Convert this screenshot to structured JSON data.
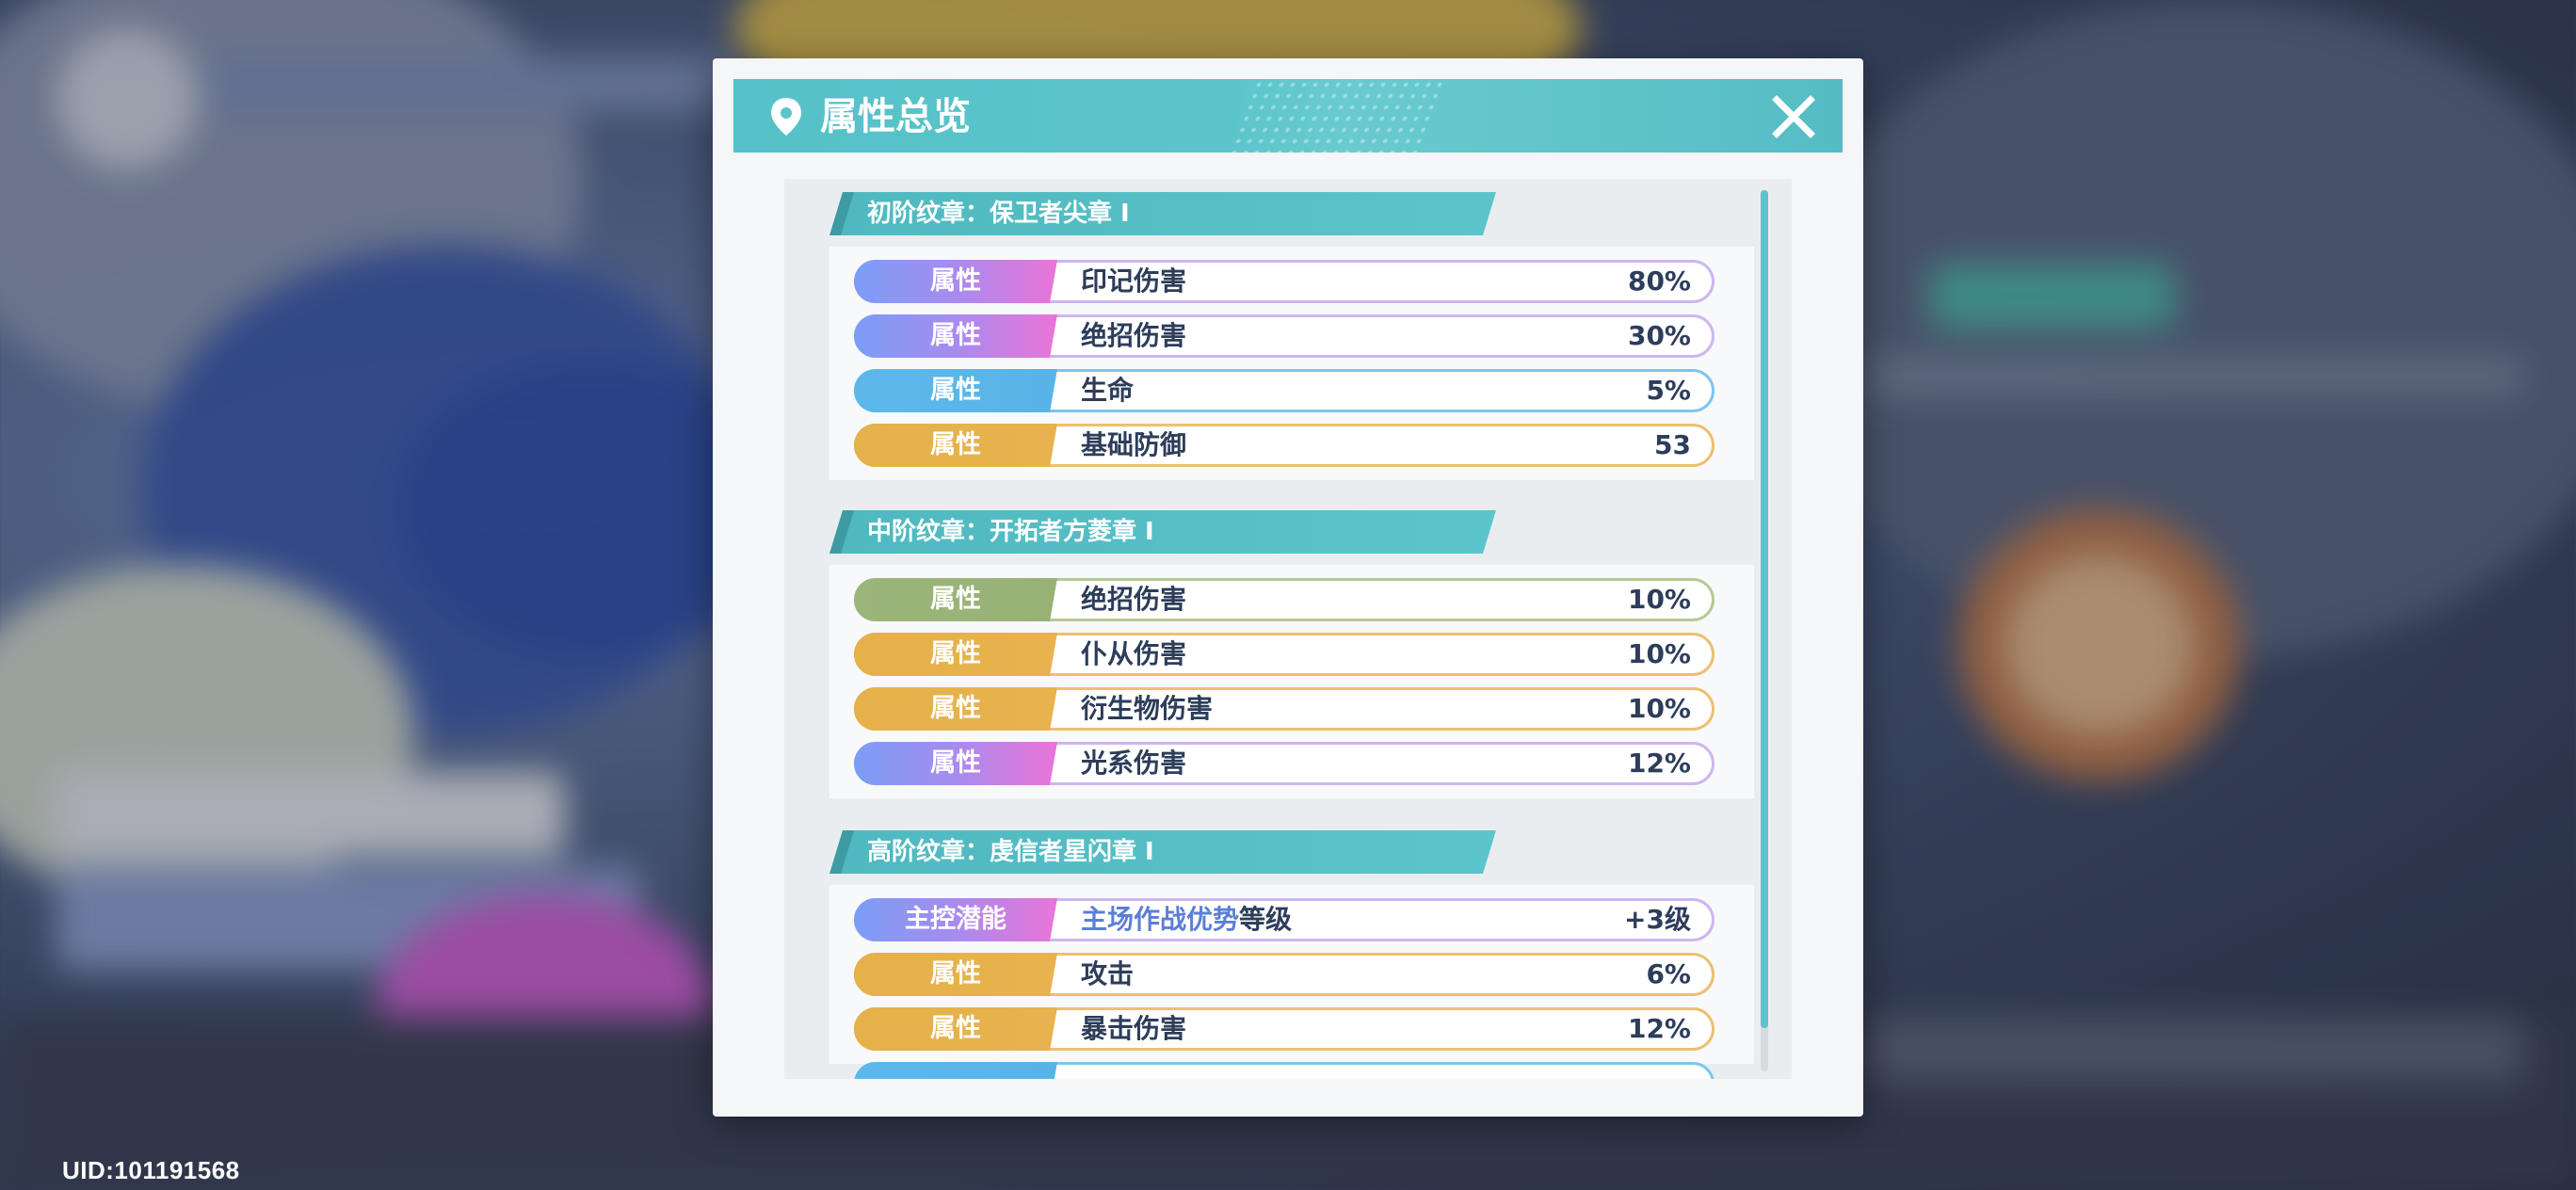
{
  "uid": "UID:101191568",
  "modal": {
    "title": "属性总览",
    "icons": {
      "pin": "location-pin-icon",
      "close": "close-icon"
    }
  },
  "sections": [
    {
      "title": "初阶纹章：保卫者尖章 Ⅰ",
      "rows": [
        {
          "tag": "属性",
          "name": "印记伤害",
          "value": "80%",
          "style": "purple"
        },
        {
          "tag": "属性",
          "name": "绝招伤害",
          "value": "30%",
          "style": "purple"
        },
        {
          "tag": "属性",
          "name": "生命",
          "value": "5%",
          "style": "blue"
        },
        {
          "tag": "属性",
          "name": "基础防御",
          "value": "53",
          "style": "gold"
        }
      ]
    },
    {
      "title": "中阶纹章：开拓者方菱章 Ⅰ",
      "rows": [
        {
          "tag": "属性",
          "name": "绝招伤害",
          "value": "10%",
          "style": "green"
        },
        {
          "tag": "属性",
          "name": "仆从伤害",
          "value": "10%",
          "style": "gold"
        },
        {
          "tag": "属性",
          "name": "衍生物伤害",
          "value": "10%",
          "style": "gold"
        },
        {
          "tag": "属性",
          "name": "光系伤害",
          "value": "12%",
          "style": "purple"
        }
      ]
    },
    {
      "title": "高阶纹章：虔信者星闪章 Ⅰ",
      "rows": [
        {
          "tag": "主控潜能",
          "name_highlight": "主场作战优势",
          "name_suffix": "等级",
          "value": "+3级",
          "style": "purple"
        },
        {
          "tag": "属性",
          "name": "攻击",
          "value": "6%",
          "style": "gold"
        },
        {
          "tag": "属性",
          "name": "暴击伤害",
          "value": "12%",
          "style": "gold"
        }
      ]
    }
  ],
  "colors": {
    "header": "#5cc5cb",
    "text": "#2d3d5a",
    "purple": "#a28df0",
    "blue": "#58b4e8",
    "gold": "#e8b24e",
    "green": "#98b175"
  }
}
